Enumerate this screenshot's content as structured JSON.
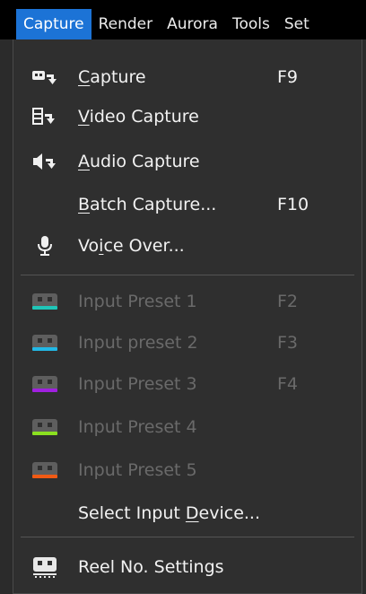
{
  "menubar": {
    "items": [
      "Capture",
      "Render",
      "Aurora",
      "Tools",
      "Set"
    ]
  },
  "menu": {
    "capture": {
      "pre": "",
      "acc": "C",
      "post": "apture",
      "shortcut": "F9"
    },
    "video_capture": {
      "pre": "",
      "acc": "V",
      "post": "ideo Capture"
    },
    "audio_capture": {
      "pre": "",
      "acc": "A",
      "post": "udio Capture"
    },
    "batch_capture": {
      "pre": "",
      "acc": "B",
      "post": "atch Capture...",
      "shortcut": "F10"
    },
    "voice_over": {
      "pre": "Vo",
      "acc": "i",
      "post": "ce Over..."
    },
    "presets": [
      {
        "label": "Input Preset 1",
        "shortcut": "F2",
        "color": "#1fc6b8"
      },
      {
        "label": "Input preset 2",
        "shortcut": "F3",
        "color": "#22b8e6"
      },
      {
        "label": "Input Preset 3",
        "shortcut": "F4",
        "color": "#a020e0"
      },
      {
        "label": "Input Preset 4",
        "shortcut": "",
        "color": "#8be020"
      },
      {
        "label": "Input Preset 5",
        "shortcut": "",
        "color": "#f05a14"
      }
    ],
    "select_input_device": {
      "pre": "Select Input ",
      "acc": "D",
      "post": "evice..."
    },
    "reel_settings": {
      "label": "Reel No. Settings"
    }
  },
  "colors": {
    "menubar_active": "#1c73d6",
    "menu_bg": "#2f2f2f",
    "text": "#f2f2f2",
    "disabled_text": "#6a6a6a"
  }
}
